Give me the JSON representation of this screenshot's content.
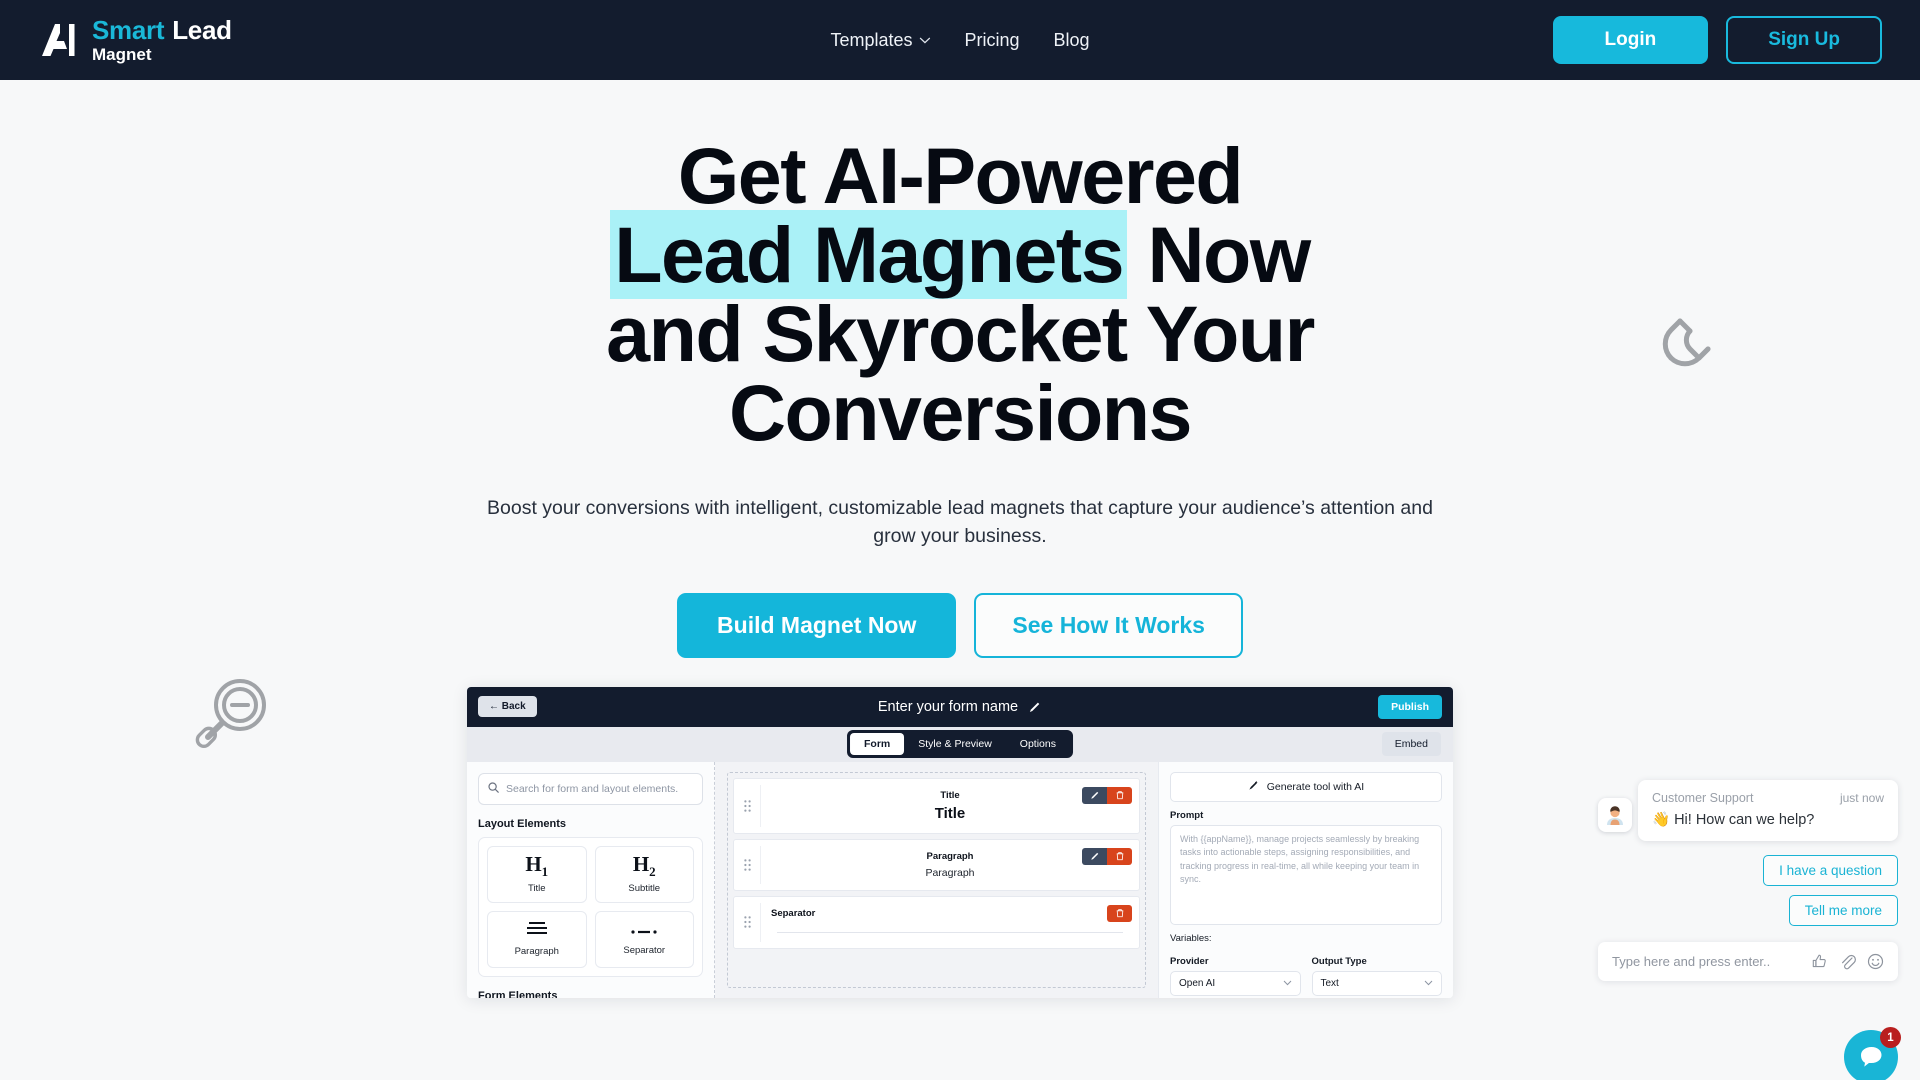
{
  "brand": {
    "logo_ai": "AI",
    "name_part1": "Smart",
    "name_part2": "Lead",
    "name_part3": "Magnet",
    "accent_color": "#17b9dc",
    "navbar_color": "#131c2e"
  },
  "nav": {
    "links": [
      {
        "label": "Templates",
        "has_dropdown": true
      },
      {
        "label": "Pricing",
        "has_dropdown": false
      },
      {
        "label": "Blog",
        "has_dropdown": false
      }
    ],
    "login_label": "Login",
    "signup_label": "Sign Up"
  },
  "hero": {
    "title_line1": "Get AI-Powered",
    "title_highlight": "Lead Magnets",
    "title_after_highlight": "Now",
    "title_line3": "and Skyrocket Your",
    "title_line4": "Conversions",
    "highlight_color": "#aaf1f7",
    "subtitle": "Boost your conversions with intelligent, customizable lead magnets that capture your audience’s attention and grow your business.",
    "primary_cta": "Build Magnet Now",
    "secondary_cta": "See How It Works"
  },
  "decorations": {
    "magnify_icon": "magnify-minus-icon",
    "magnet_icon": "magnet-icon"
  },
  "app": {
    "topbar": {
      "back_label": "← Back",
      "form_name": "Enter your form name",
      "edit_icon": "pencil-icon",
      "publish_label": "Publish"
    },
    "tabbar": {
      "tabs": [
        {
          "label": "Form",
          "active": true
        },
        {
          "label": "Style & Preview",
          "active": false
        },
        {
          "label": "Options",
          "active": false
        }
      ],
      "embed_label": "Embed"
    },
    "left_panel": {
      "search_placeholder": "Search for form and layout elements.",
      "search_icon": "search-icon",
      "layout_heading": "Layout Elements",
      "layout_elements": [
        {
          "glyph": "H",
          "sub": "1",
          "label": "Title"
        },
        {
          "glyph": "H",
          "sub": "2",
          "label": "Subtitle"
        },
        {
          "glyph": "paragraph-lines-icon",
          "sub": "",
          "label": "Paragraph"
        },
        {
          "glyph": "separator-dash-icon",
          "sub": "",
          "label": "Separator"
        }
      ],
      "form_heading": "Form Elements"
    },
    "canvas": {
      "cards": [
        {
          "kind": "Title",
          "value": "Title",
          "style": "title",
          "has_edit": true,
          "has_delete": true
        },
        {
          "kind": "Paragraph",
          "value": "Paragraph",
          "style": "paragraph",
          "has_edit": true,
          "has_delete": true
        },
        {
          "kind": "Separator",
          "value": "",
          "style": "separator",
          "has_edit": false,
          "has_delete": true
        }
      ],
      "drag_handle_icon": "drag-handle-icon",
      "edit_icon": "pencil-icon",
      "delete_icon": "trash-icon"
    },
    "right_panel": {
      "generate_label": "Generate tool with AI",
      "generate_icon": "magic-wand-icon",
      "prompt_label": "Prompt",
      "prompt_placeholder": "With {{appName}}, manage projects seamlessly by breaking tasks into actionable steps, assigning responsibilities, and tracking progress in real-time, all while keeping your team in sync.",
      "variables_label": "Variables:",
      "provider_label": "Provider",
      "provider_value": "Open AI",
      "output_label": "Output Type",
      "output_value": "Text"
    }
  },
  "chat": {
    "avatar_icon": "support-agent-avatar",
    "sender": "Customer Support",
    "time": "just now",
    "message": "👋 Hi! How can we help?",
    "quick_replies": [
      "I have a question",
      "Tell me more"
    ],
    "input_placeholder": "Type here and press enter..",
    "input_icons": [
      "thumbs-up-icon",
      "paperclip-icon",
      "emoji-icon"
    ],
    "fab_icon": "chat-bubble-icon",
    "fab_badge": "1",
    "fab_color": "#19b5d6",
    "badge_color": "#b91f1f"
  }
}
